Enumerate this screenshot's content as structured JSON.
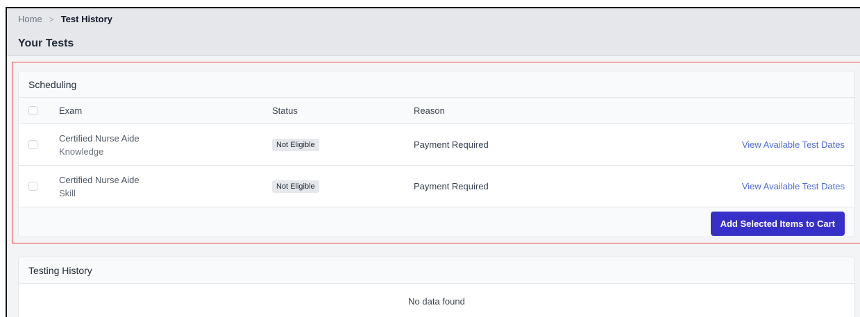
{
  "breadcrumb": {
    "home": "Home",
    "separator": ">",
    "current": "Test History"
  },
  "page_title": "Your Tests",
  "scheduling": {
    "title": "Scheduling",
    "columns": {
      "exam": "Exam",
      "status": "Status",
      "reason": "Reason"
    },
    "rows": [
      {
        "exam": "Certified Nurse Aide",
        "type": "Knowledge",
        "status": "Not Eligible",
        "reason": "Payment Required",
        "action": "View Available Test Dates"
      },
      {
        "exam": "Certified Nurse Aide",
        "type": "Skill",
        "status": "Not Eligible",
        "reason": "Payment Required",
        "action": "View Available Test Dates"
      }
    ],
    "cart_button": "Add Selected Items to Cart"
  },
  "history": {
    "title": "Testing History",
    "empty_text": "No data found"
  },
  "colors": {
    "accent": "#3730c8",
    "link": "#4f6bd8",
    "highlight": "#ef4444"
  }
}
